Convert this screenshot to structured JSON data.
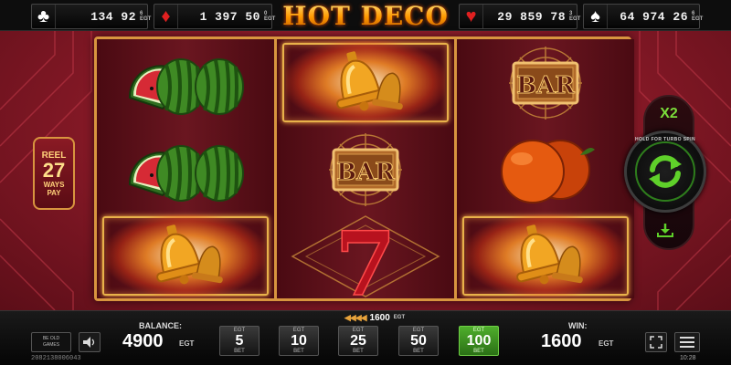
{
  "game": {
    "title": "HOT DECO"
  },
  "jackpots": [
    {
      "suit": "clubs-icon",
      "glyph": "♣",
      "color": "#ffffff",
      "value": "134 92",
      "small": "6"
    },
    {
      "suit": "diamonds-icon",
      "glyph": "♦",
      "color": "#e02020",
      "value": "1 397 50",
      "small": "0"
    },
    {
      "suit": "hearts-icon",
      "glyph": "♥",
      "color": "#e02020",
      "value": "29 859 78",
      "small": "3"
    },
    {
      "suit": "spades-icon",
      "glyph": "♠",
      "color": "#ffffff",
      "value": "64 974 26",
      "small": "6"
    }
  ],
  "jackpot_currency": "EGT",
  "reels": [
    [
      "watermelon",
      "watermelon",
      "bell"
    ],
    [
      "bell",
      "bar",
      "seven"
    ],
    [
      "bar",
      "orange",
      "bell"
    ]
  ],
  "bar_text": "BAR",
  "seven_text": "7",
  "reel_badge": {
    "line1": "REEL",
    "line2": "27",
    "line3": "WAYS",
    "line4": "PAY"
  },
  "turbo": {
    "multiplier": "X2",
    "label": "HOLD FOR TURBO SPIN"
  },
  "win_indicator": {
    "amount": "1600",
    "currency": "EGT"
  },
  "bottom": {
    "logo_line1": "BE OLD",
    "logo_line2": "GAMES",
    "ticket": "2082138006043",
    "balance_label": "BALANCE:",
    "balance_value": "4900",
    "balance_currency": "EGT",
    "win_label": "WIN:",
    "win_value": "1600",
    "win_currency": "EGT",
    "clock": "10:28"
  },
  "bets": [
    {
      "top": "EGT",
      "value": "5",
      "bottom": "BET",
      "active": false
    },
    {
      "top": "EGT",
      "value": "10",
      "bottom": "BET",
      "active": false
    },
    {
      "top": "EGT",
      "value": "25",
      "bottom": "BET",
      "active": false
    },
    {
      "top": "EGT",
      "value": "50",
      "bottom": "BET",
      "active": false
    },
    {
      "top": "EGT",
      "value": "100",
      "bottom": "BET",
      "active": true
    }
  ]
}
